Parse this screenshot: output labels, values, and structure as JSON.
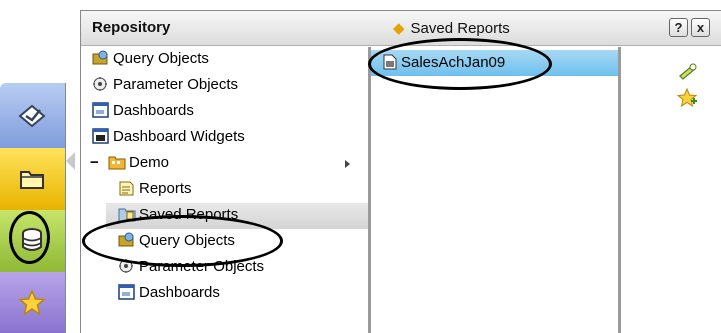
{
  "rail": {
    "items": [
      {
        "name": "sent-reports",
        "icon": "envelope-arrow-icon",
        "color": "#9fb6e8"
      },
      {
        "name": "folders",
        "icon": "folder-icon",
        "color": "#f5cb1c"
      },
      {
        "name": "repository",
        "icon": "database-icon",
        "color": "#a9cf4c",
        "selected": true
      },
      {
        "name": "favourites",
        "icon": "star-icon",
        "color": "#a290dc"
      }
    ]
  },
  "header": {
    "title": "Repository",
    "current_folder": "Saved Reports",
    "help_label": "?",
    "close_label": "x"
  },
  "tree": {
    "items": [
      {
        "label": "Query Objects",
        "icon": "query-objects-icon"
      },
      {
        "label": "Parameter Objects",
        "icon": "parameter-objects-icon"
      },
      {
        "label": "Dashboards",
        "icon": "dashboard-icon"
      },
      {
        "label": "Dashboard Widgets",
        "icon": "dashboard-widget-icon"
      },
      {
        "label": "Demo",
        "icon": "folder-icon",
        "expander": "−"
      },
      {
        "label": "Reports",
        "icon": "reports-icon"
      },
      {
        "label": "Saved Reports",
        "icon": "saved-reports-icon",
        "selected": true
      },
      {
        "label": "Query Objects",
        "icon": "query-objects-icon"
      },
      {
        "label": "Parameter Objects",
        "icon": "parameter-objects-icon"
      },
      {
        "label": "Dashboards",
        "icon": "dashboard-icon"
      }
    ]
  },
  "content": {
    "items": [
      {
        "label": "SalesAchJan09",
        "icon": "saved-report-file-icon",
        "selected": true
      }
    ]
  },
  "actions": [
    {
      "name": "run-report",
      "icon": "run-icon"
    },
    {
      "name": "add-favourite",
      "icon": "favourite-add-icon"
    }
  ],
  "colors": {
    "selection_blue": "#79c4ee",
    "highlight_gray": "#d4d4d4",
    "accent_orange": "#e5a300"
  }
}
